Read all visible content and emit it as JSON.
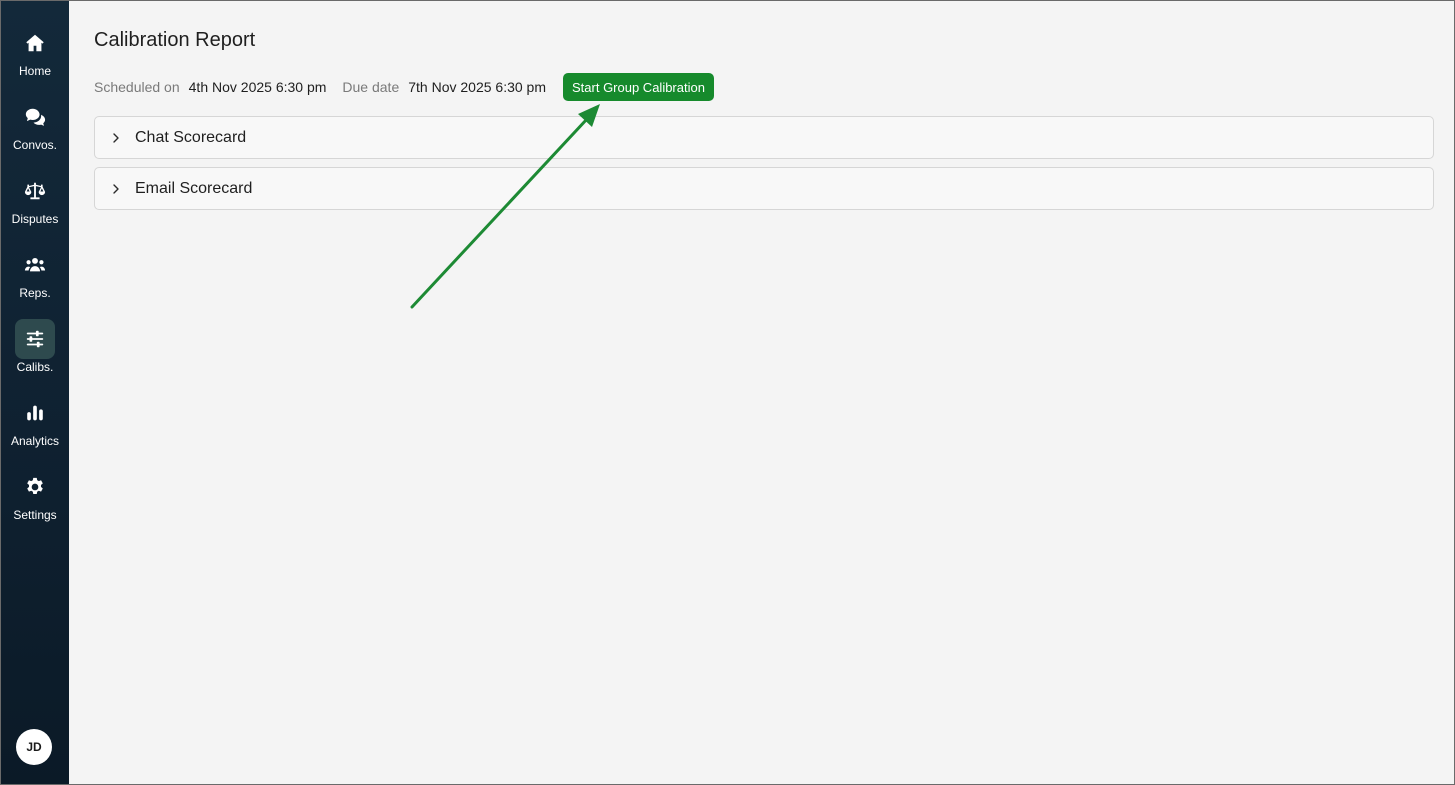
{
  "sidebar": {
    "items": [
      {
        "label": "Home",
        "icon": "home-icon",
        "active": false
      },
      {
        "label": "Convos.",
        "icon": "chat-bubbles-icon",
        "active": false
      },
      {
        "label": "Disputes",
        "icon": "scale-icon",
        "active": false
      },
      {
        "label": "Reps.",
        "icon": "users-icon",
        "active": false
      },
      {
        "label": "Calibs.",
        "icon": "sliders-icon",
        "active": true
      },
      {
        "label": "Analytics",
        "icon": "bar-chart-icon",
        "active": false
      },
      {
        "label": "Settings",
        "icon": "gear-icon",
        "active": false
      }
    ],
    "avatar_initials": "JD"
  },
  "page": {
    "title": "Calibration Report",
    "scheduled_label": "Scheduled on",
    "scheduled_value": "4th Nov 2025 6:30 pm",
    "due_label": "Due date",
    "due_value": "7th Nov 2025 6:30 pm",
    "start_button_label": "Start Group Calibration"
  },
  "scorecards": [
    {
      "label": "Chat Scorecard"
    },
    {
      "label": "Email Scorecard"
    }
  ],
  "colors": {
    "accent_green": "#168a2c",
    "sidebar_bg": "#0f2131",
    "annotation_arrow": "#1d8a34"
  }
}
